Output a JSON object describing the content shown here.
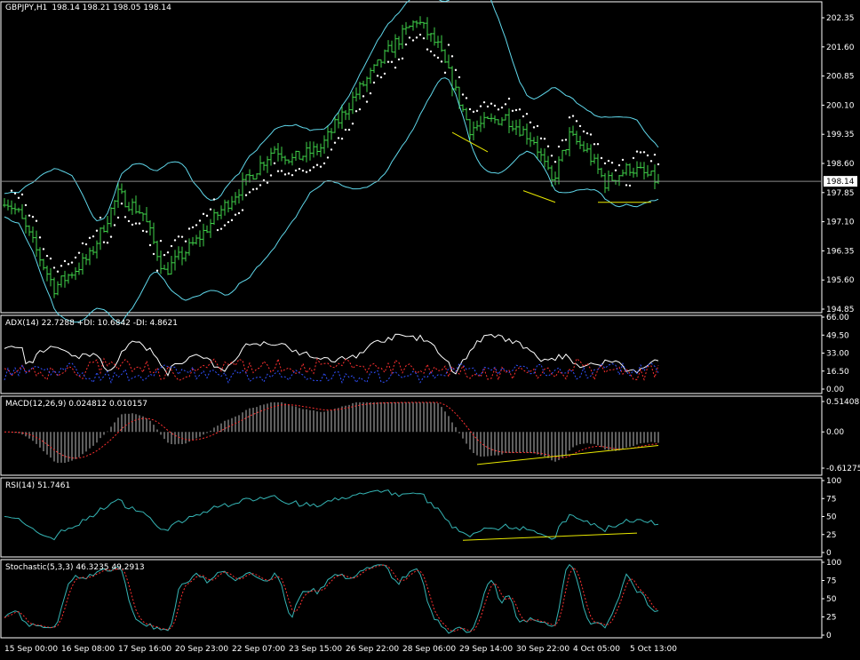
{
  "header": {
    "symbol": "GBPJPY,H1",
    "ohlc": "198.14 198.21 198.05 198.14"
  },
  "colors": {
    "bars": "#3fd24a",
    "bands": "#5fd7ea",
    "sar": "#ffffff",
    "trend": "#e8e800",
    "signal": "#ff3030",
    "minus_di": "#3050ff",
    "rsi": "#35b5b5",
    "grid": "#ffffff"
  },
  "chart_data": [
    {
      "type": "line",
      "name": "price",
      "title": "GBPJPY,H1 198.14 198.21 198.05 198.14",
      "ylim": [
        194.85,
        202.35
      ],
      "yticks": [
        "202.35",
        "201.60",
        "200.85",
        "200.10",
        "199.35",
        "198.60",
        "197.85",
        "197.10",
        "196.35",
        "195.60",
        "194.85"
      ],
      "current_price": "198.14",
      "keypoints": [
        [
          0,
          197.7
        ],
        [
          4,
          197.3
        ],
        [
          14,
          195.4
        ],
        [
          24,
          196.2
        ],
        [
          32,
          197.8
        ],
        [
          39,
          197.3
        ],
        [
          45,
          195.8
        ],
        [
          54,
          196.6
        ],
        [
          61,
          197.4
        ],
        [
          76,
          199.0
        ],
        [
          81,
          198.7
        ],
        [
          89,
          199.0
        ],
        [
          99,
          200.4
        ],
        [
          109,
          201.6
        ],
        [
          116,
          202.3
        ],
        [
          122,
          201.6
        ],
        [
          131,
          199.5
        ],
        [
          141,
          199.8
        ],
        [
          149,
          199.2
        ],
        [
          154,
          198.1
        ],
        [
          159,
          199.3
        ],
        [
          164,
          198.9
        ],
        [
          169,
          198.1
        ],
        [
          176,
          198.5
        ],
        [
          184,
          198.14
        ]
      ],
      "trendlines": [
        [
          [
            126,
            199.4
          ],
          [
            136,
            198.9
          ]
        ],
        [
          [
            146,
            197.9
          ],
          [
            155,
            197.6
          ]
        ],
        [
          [
            167,
            197.6
          ],
          [
            182,
            197.6
          ]
        ]
      ]
    },
    {
      "type": "line",
      "name": "adx",
      "title": "ADX(14) 22.7288  +DI: 10.6842  -DI: 4.8621",
      "ylim": [
        0,
        66
      ],
      "yticks": [
        "66.00",
        "49.50",
        "33.00",
        "16.50",
        "0.00"
      ]
    },
    {
      "type": "bar",
      "name": "macd",
      "title": "MACD(12,26,9)  0.024812  0.010157",
      "ylim": [
        -0.61275,
        0.51408
      ],
      "yticks": [
        "0.51408",
        "0.00",
        "-0.61275"
      ],
      "trendline": [
        [
          133,
          -0.55
        ],
        [
          184,
          -0.23
        ]
      ]
    },
    {
      "type": "line",
      "name": "rsi",
      "title": "RSI(14)  51.7461",
      "ylim": [
        0,
        100
      ],
      "yticks": [
        "100",
        "75",
        "50",
        "25",
        "0"
      ],
      "trendline": [
        [
          129,
          17
        ],
        [
          178,
          27
        ]
      ]
    },
    {
      "type": "line",
      "name": "stochastic",
      "title": "Stochastic(5,3,3)  46.3235  49.2913",
      "ylim": [
        0,
        100
      ],
      "yticks": [
        "100",
        "75",
        "50",
        "25",
        "0"
      ]
    }
  ],
  "xaxis": {
    "labels": [
      "15 Sep 00:00",
      "16 Sep 08:00",
      "17 Sep 16:00",
      "20 Sep 23:00",
      "22 Sep 07:00",
      "23 Sep 15:00",
      "26 Sep 22:00",
      "28 Sep 06:00",
      "29 Sep 14:00",
      "30 Sep 22:00",
      "4 Oct 05:00",
      "5 Oct 13:00"
    ],
    "bars_per_label": 16
  }
}
